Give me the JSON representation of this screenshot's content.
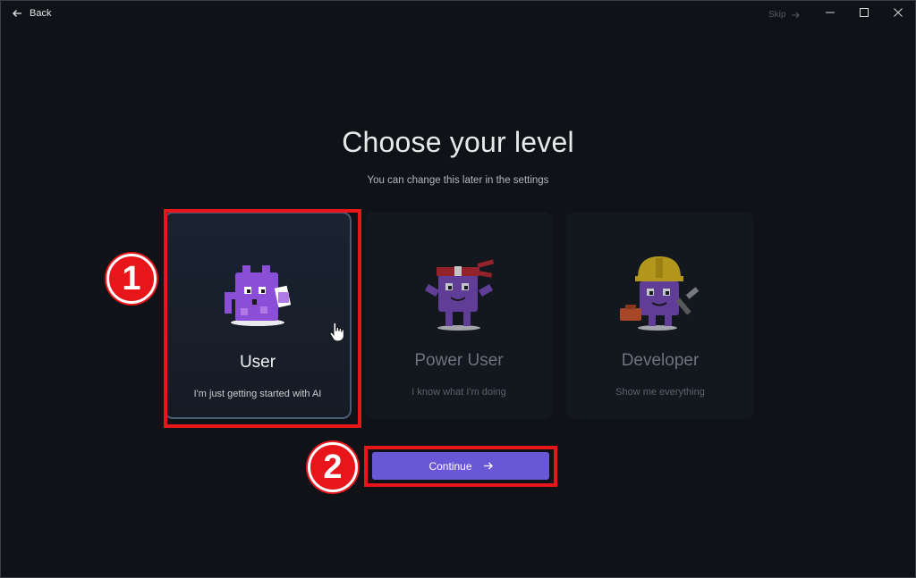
{
  "titlebar": {
    "back_label": "Back",
    "skip_label": "Skip"
  },
  "heading": {
    "title": "Choose your level",
    "subtitle": "You can change this later in the settings"
  },
  "levels": [
    {
      "title": "User",
      "description": "I'm just getting started with AI",
      "selected": true,
      "icon": "mascot-user-icon"
    },
    {
      "title": "Power User",
      "description": "I know what I'm doing",
      "selected": false,
      "icon": "mascot-power-user-icon"
    },
    {
      "title": "Developer",
      "description": "Show me everything",
      "selected": false,
      "icon": "mascot-developer-icon"
    }
  ],
  "continue_label": "Continue",
  "annotations": {
    "step1": "1",
    "step2": "2"
  },
  "colors": {
    "background": "#0f1217",
    "accent": "#6a57d6",
    "mascot": "#8a4fd6",
    "annotation": "#e8151b"
  }
}
